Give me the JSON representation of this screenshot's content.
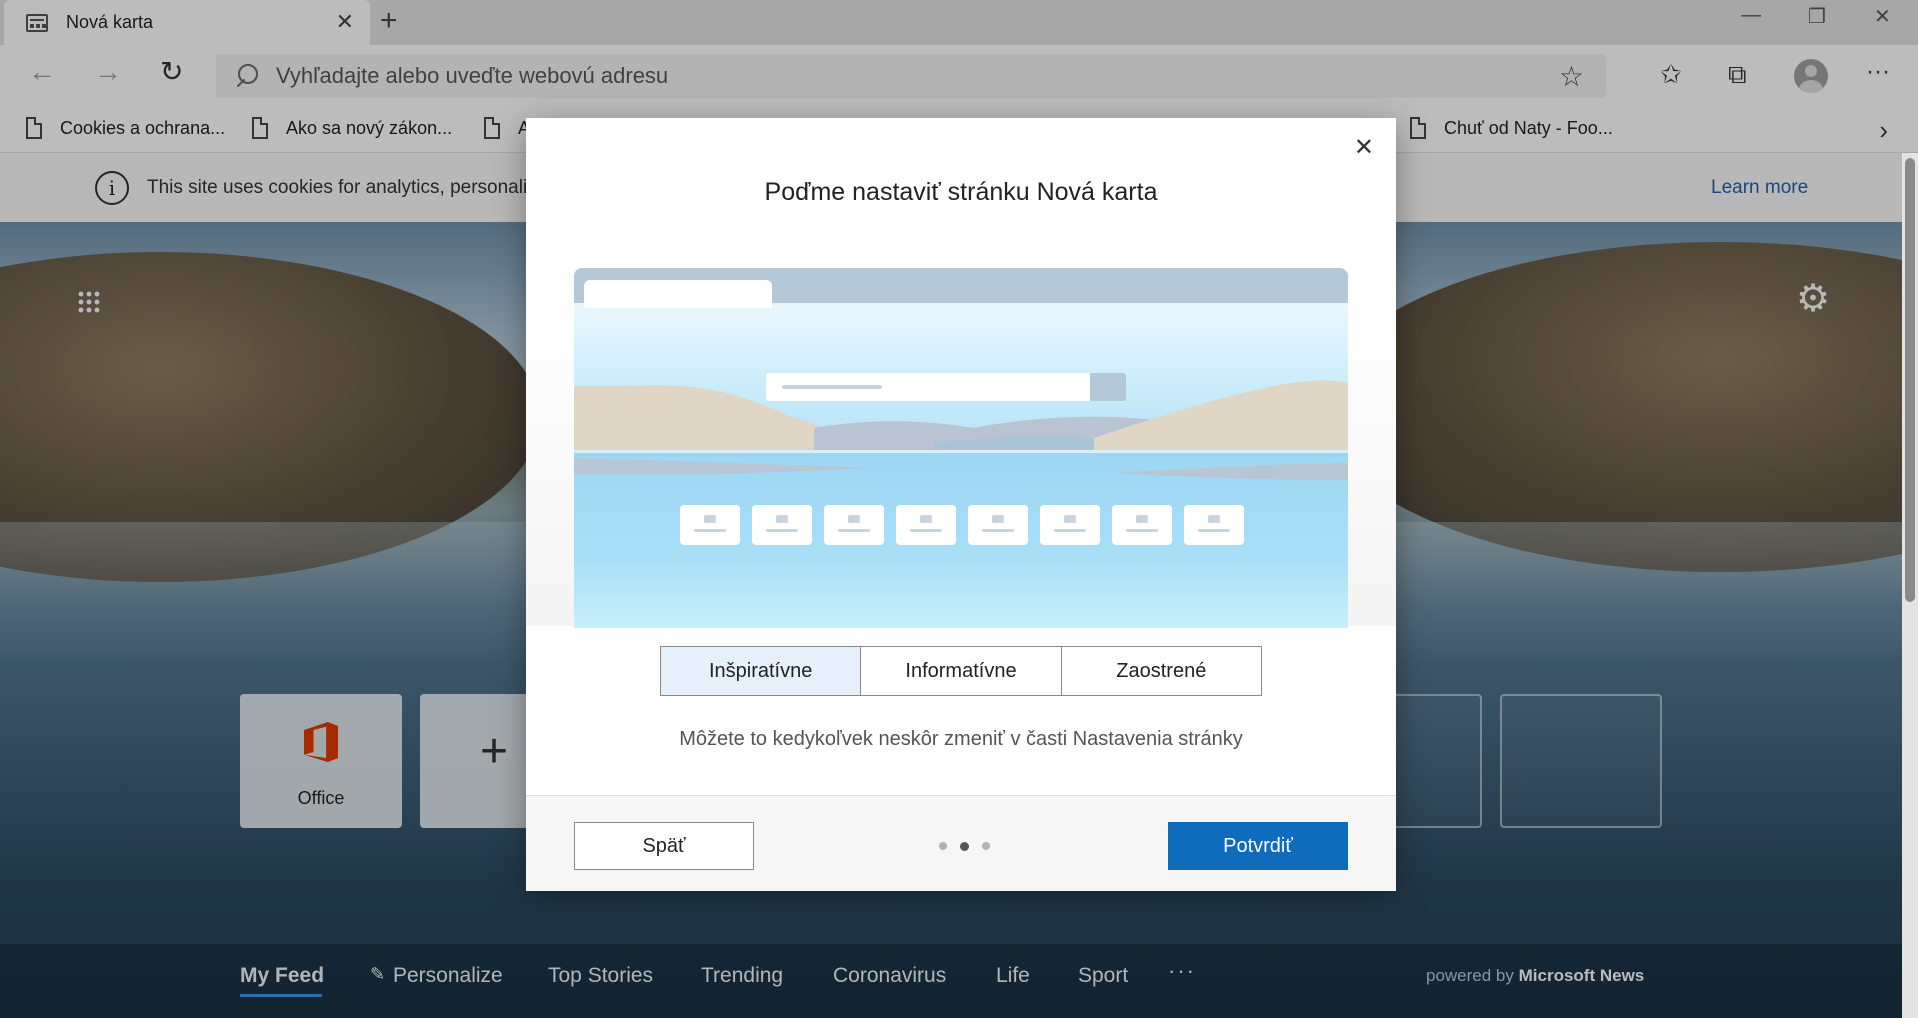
{
  "browser": {
    "tab_title": "Nová karta",
    "address_placeholder": "Vyhľadajte alebo uveďte webovú adresu"
  },
  "favorites": [
    "Cookies a ochrana...",
    "Ako sa nový zákon...",
    "A",
    "Chuť od Naty - Foo..."
  ],
  "cookie_banner": {
    "message": "This site uses cookies for analytics, personali",
    "learn_more": "Learn more"
  },
  "tiles": {
    "office_label": "Office"
  },
  "feed": {
    "items": [
      "My Feed",
      "Personalize",
      "Top Stories",
      "Trending",
      "Coronavirus",
      "Life",
      "Sport"
    ],
    "more": "···",
    "powered_prefix": "powered by",
    "powered_brand": "Microsoft News"
  },
  "dialog": {
    "title": "Poďme nastaviť stránku Nová karta",
    "layouts": [
      "Inšpiratívne",
      "Informatívne",
      "Zaostrené"
    ],
    "selected_layout": "Inšpiratívne",
    "hint": "Môžete to kedykoľvek neskôr zmeniť v časti Nastavenia stránky",
    "back_label": "Späť",
    "confirm_label": "Potvrdiť",
    "step_current": 2,
    "step_total": 3
  },
  "colors": {
    "accent": "#0f6cbd",
    "office": "#d83b01",
    "link": "#1f5fa8"
  }
}
